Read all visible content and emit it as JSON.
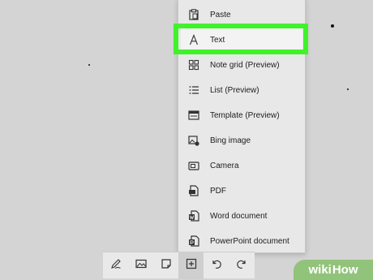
{
  "menu": {
    "items": [
      {
        "label": "Paste",
        "icon": "clipboard-icon"
      },
      {
        "label": "Text",
        "icon": "text-icon",
        "highlighted": true
      },
      {
        "label": "Note grid (Preview)",
        "icon": "note-grid-icon"
      },
      {
        "label": "List (Preview)",
        "icon": "list-icon"
      },
      {
        "label": "Template (Preview)",
        "icon": "template-icon"
      },
      {
        "label": "Bing image",
        "icon": "bing-image-icon"
      },
      {
        "label": "Camera",
        "icon": "camera-icon"
      },
      {
        "label": "PDF",
        "icon": "pdf-icon"
      },
      {
        "label": "Word document",
        "icon": "word-document-icon"
      },
      {
        "label": "PowerPoint document",
        "icon": "powerpoint-document-icon"
      }
    ],
    "highlight_color": "#3ff22a"
  },
  "toolbar": {
    "buttons": [
      {
        "icon": "pen-icon"
      },
      {
        "icon": "image-icon"
      },
      {
        "icon": "sticky-note-icon"
      },
      {
        "icon": "add-icon",
        "active": true
      },
      {
        "icon": "undo-icon"
      },
      {
        "icon": "redo-icon"
      }
    ]
  },
  "watermark": {
    "part1": "wiki",
    "part2": "How"
  },
  "colors": {
    "canvas": "#d4d4d4",
    "menu_background": "#e8e8e8",
    "watermark_green": "#92c37a"
  }
}
